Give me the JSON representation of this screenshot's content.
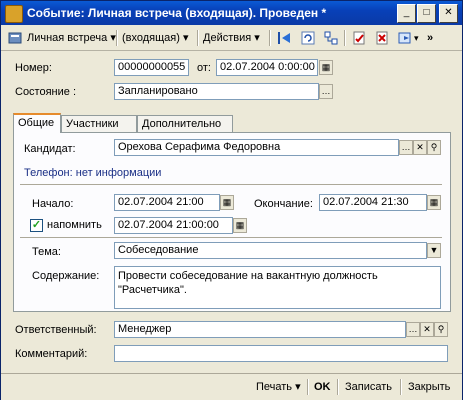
{
  "window": {
    "title": "Событие: Личная встреча (входящая). Проведен *",
    "min_glyph": "_",
    "max_glyph": "□",
    "close_glyph": "✕"
  },
  "toolbar": {
    "type_menu": "Личная встреча ▾",
    "direction_menu": "(входящая) ▾",
    "actions_menu": "Действия ▾"
  },
  "header": {
    "number_label": "Номер:",
    "number_value": "00000000055",
    "date_label": "от:",
    "date_value": "02.07.2004  0:00:00",
    "state_label": "Состояние :",
    "state_value": "Запланировано"
  },
  "tabs": [
    "Общие",
    "Участники",
    "Дополнительно"
  ],
  "general": {
    "candidate_label": "Кандидат:",
    "candidate_value": "Орехова Серафима Федоровна",
    "phone_text": "Телефон: нет информации",
    "start_label": "Начало:",
    "start_value": "02.07.2004 21:00",
    "end_label": "Окончание:",
    "end_value": "02.07.2004 21:30",
    "remind_label": "напомнить",
    "remind_value": "02.07.2004 21:00:00",
    "topic_label": "Тема:",
    "topic_value": "Собеседование",
    "content_label": "Содержание:",
    "content_value": "Провести собеседование на вакантную должность\n\"Расчетчика\"."
  },
  "footer": {
    "responsible_label": "Ответственный:",
    "responsible_value": "Менеджер",
    "comment_label": "Комментарий:",
    "comment_value": ""
  },
  "bottom": {
    "print": "Печать ▾",
    "ok": "OK",
    "save": "Записать",
    "close": "Закрыть"
  }
}
